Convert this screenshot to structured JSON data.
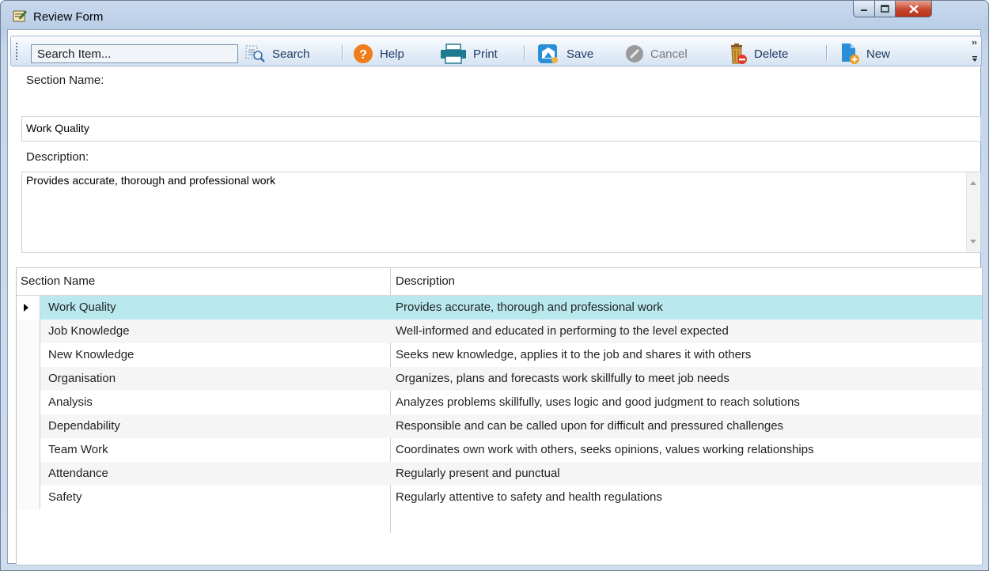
{
  "window": {
    "title": "Review Form"
  },
  "toolbar": {
    "search_placeholder": "Search Item...",
    "search_label": "Search",
    "help_label": "Help",
    "print_label": "Print",
    "save_label": "Save",
    "cancel_label": "Cancel",
    "delete_label": "Delete",
    "new_label": "New"
  },
  "form": {
    "section_name_label": "Section Name:",
    "section_name_value": "Work Quality",
    "description_label": "Description:",
    "description_value": "Provides accurate, thorough and professional work"
  },
  "grid": {
    "columns": [
      "Section Name",
      "Description"
    ],
    "rows": [
      {
        "name": "Work Quality",
        "description": "Provides accurate, thorough and professional work"
      },
      {
        "name": "Job Knowledge",
        "description": "Well-informed and educated in performing to the level expected"
      },
      {
        "name": "New Knowledge",
        "description": "Seeks new knowledge, applies it to the job and shares it with others"
      },
      {
        "name": "Organisation",
        "description": "Organizes, plans and forecasts work skillfully to meet job needs"
      },
      {
        "name": "Analysis",
        "description": "Analyzes problems skillfully, uses logic and good judgment to reach solutions"
      },
      {
        "name": "Dependability",
        "description": "Responsible and can be called upon for difficult and pressured challenges"
      },
      {
        "name": "Team Work",
        "description": "Coordinates own work with others, seeks opinions, values working relationships"
      },
      {
        "name": "Attendance",
        "description": "Regularly present and punctual"
      },
      {
        "name": "Safety",
        "description": "Regularly attentive to safety and health regulations"
      }
    ]
  },
  "colors": {
    "selected_row": "#b9e9ef",
    "help_icon": "#f07c1c",
    "print_icon": "#1e7a8e",
    "save_icon": "#2a8fd6",
    "close_button": "#c8472f"
  }
}
